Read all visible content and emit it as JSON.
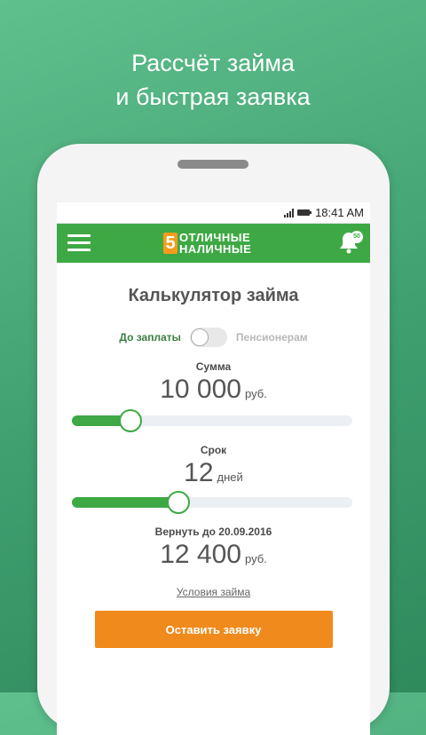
{
  "promo": {
    "line1": "Рассчёт займа",
    "line2": "и быстрая заявка"
  },
  "statusbar": {
    "time": "18:41 AM"
  },
  "appbar": {
    "logo_mark": "5",
    "logo_line1": "ОТЛИЧНЫЕ",
    "logo_line2": "НАЛИЧНЫЕ",
    "notifications_badge": "50"
  },
  "calculator": {
    "title": "Калькулятор займа",
    "toggle_left": "До заплаты",
    "toggle_right": "Пенсионерам",
    "amount_label": "Сумма",
    "amount_value": "10 000",
    "amount_unit": "руб.",
    "amount_fraction": 0.21,
    "term_label": "Срок",
    "term_value": "12",
    "term_unit": "дней",
    "term_fraction": 0.38,
    "return_label": "Вернуть до 20.09.2016",
    "return_value": "12 400",
    "return_unit": "руб.",
    "terms_link": "Условия займа",
    "submit_label": "Оставить заявку"
  },
  "colors": {
    "brand_green": "#3ea944",
    "accent_orange": "#f08a1c",
    "background_green": "#4aaa78"
  }
}
